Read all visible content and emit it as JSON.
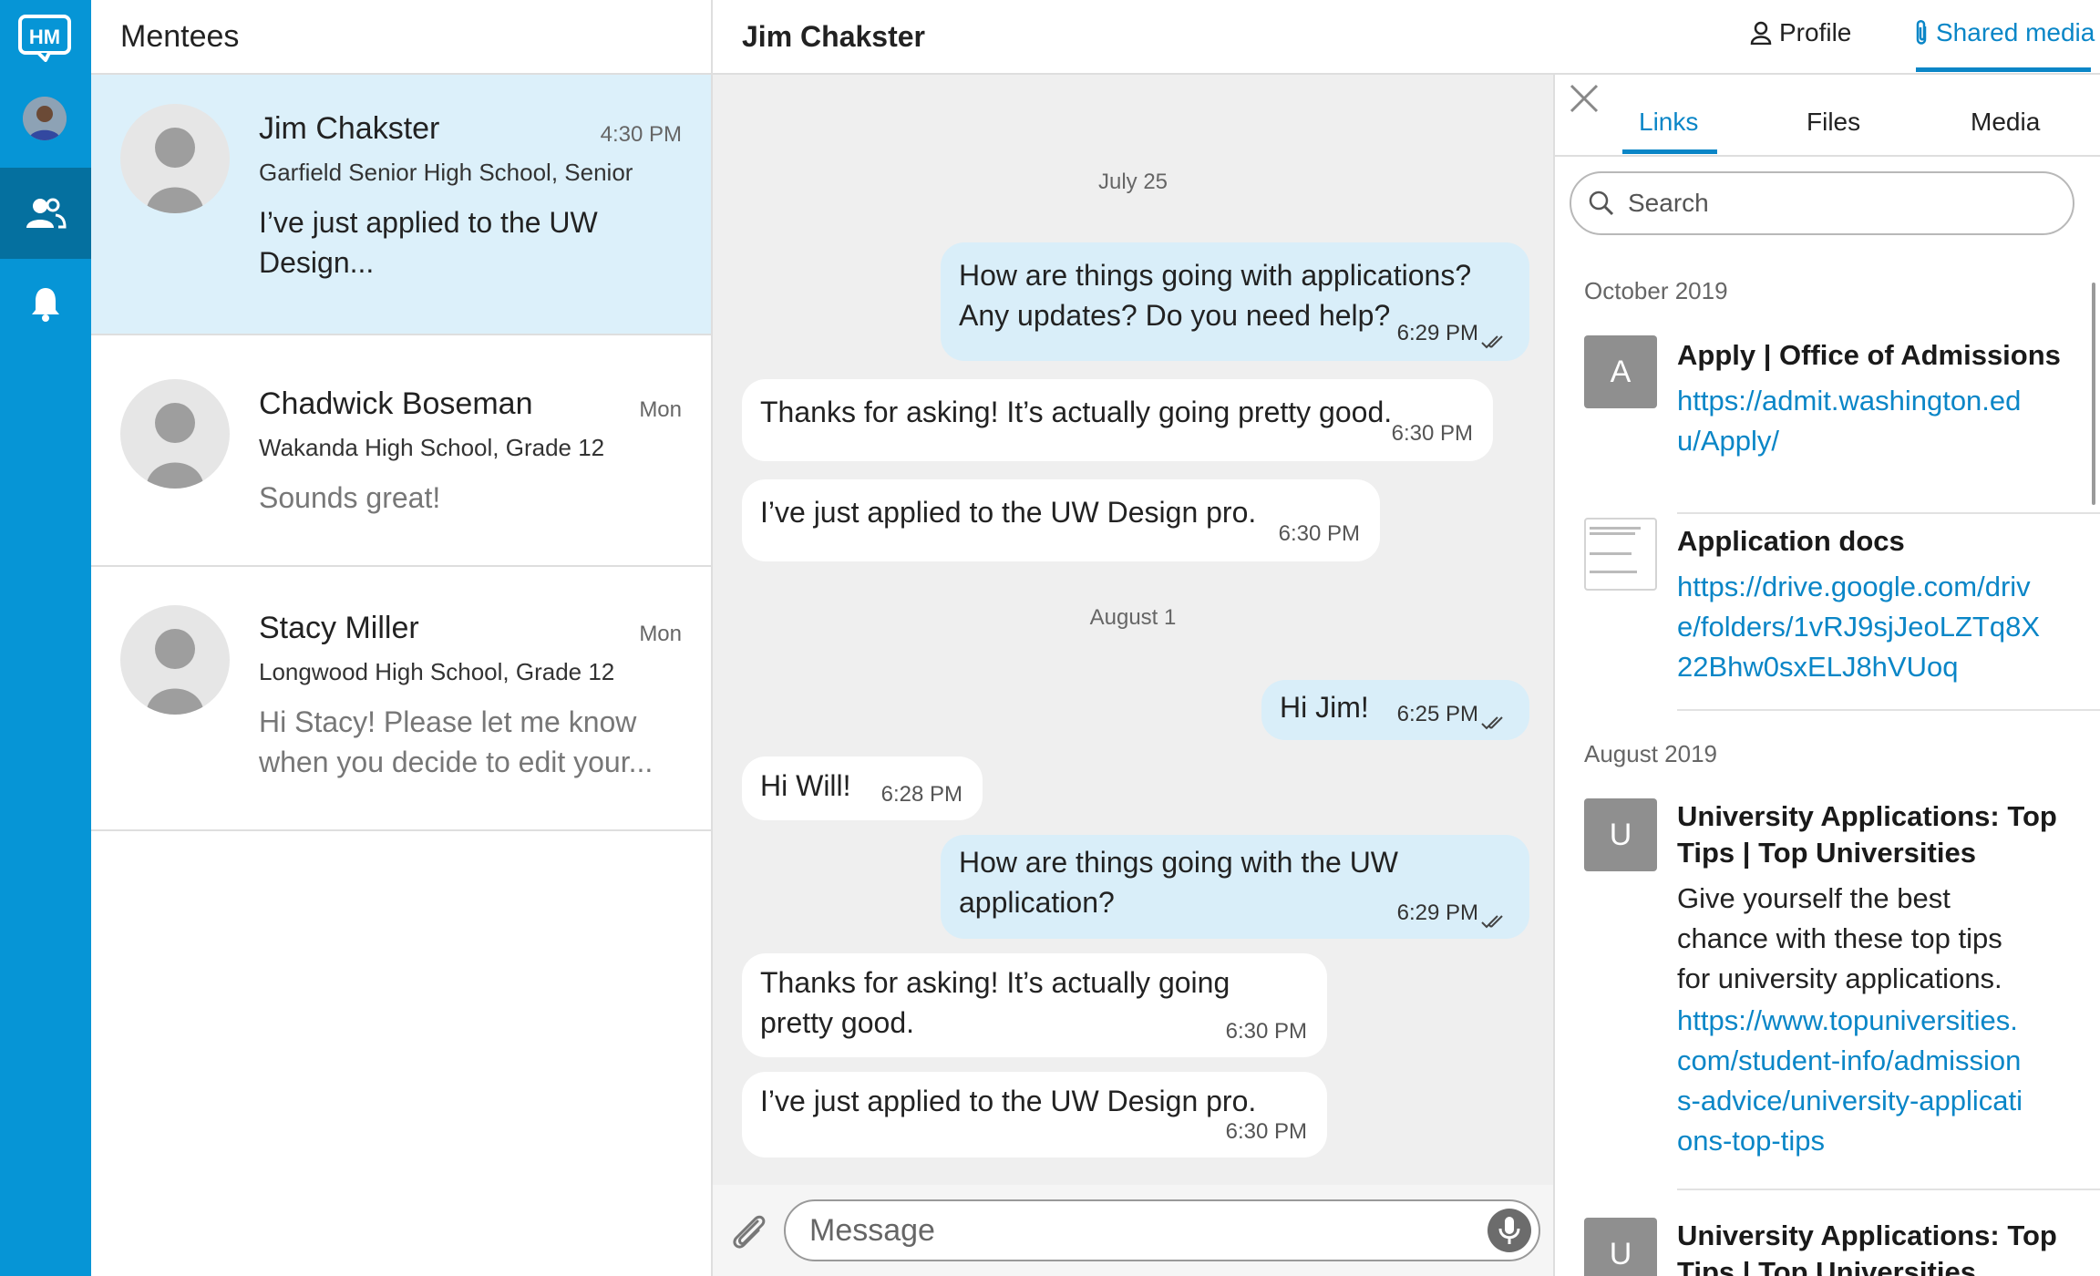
{
  "app": {
    "logo_text": "HM",
    "colors": {
      "rail": "#0695d6",
      "accent": "#0a86c7",
      "active_row": "#dcf0fa",
      "outgoing_bubble": "#d9eef9"
    }
  },
  "rail": {
    "items": [
      {
        "icon": "user-avatar"
      },
      {
        "icon": "people-icon",
        "active": true
      },
      {
        "icon": "bell-icon"
      }
    ]
  },
  "mentees": {
    "title": "Mentees",
    "items": [
      {
        "name": "Jim Chakster",
        "time": "4:30 PM",
        "school": "Garfield Senior High School, Senior",
        "preview_lines": [
          "I’ve just applied to the UW",
          "Design..."
        ],
        "active": true
      },
      {
        "name": "Chadwick Boseman",
        "time": "Mon",
        "school": "Wakanda High School, Grade 12",
        "preview_lines": [
          "Sounds great!"
        ]
      },
      {
        "name": "Stacy Miller",
        "time": "Mon",
        "school": "Longwood High School, Grade 12",
        "preview_lines": [
          "Hi Stacy! Please let me know",
          "when you decide to edit your..."
        ]
      }
    ]
  },
  "chat": {
    "title": "Jim Chakster",
    "dates": [
      "July 25",
      "August 1"
    ],
    "messages": [
      {
        "dir": "out",
        "lines": [
          "How are things going with applications?",
          "Any updates? Do you need help?"
        ],
        "time": "6:29 PM"
      },
      {
        "dir": "in",
        "lines": [
          "Thanks for asking! It’s actually going pretty good."
        ],
        "time": "6:30 PM"
      },
      {
        "dir": "in",
        "lines": [
          "I’ve just applied to the UW Design pro."
        ],
        "time": "6:30 PM"
      },
      {
        "dir": "out",
        "lines": [
          "Hi Jim!"
        ],
        "time": "6:25 PM"
      },
      {
        "dir": "in",
        "lines": [
          "Hi Will!"
        ],
        "time": "6:28 PM"
      },
      {
        "dir": "out",
        "lines": [
          "How are things going with the UW",
          "application?"
        ],
        "time": "6:29 PM"
      },
      {
        "dir": "in",
        "lines": [
          "Thanks for asking! It’s actually going",
          "pretty good."
        ],
        "time": "6:30 PM"
      },
      {
        "dir": "in",
        "lines": [
          "I’ve just applied to the UW Design pro."
        ],
        "time": "6:30 PM"
      }
    ],
    "composer": {
      "placeholder": "Message",
      "attach_icon": "paperclip-icon",
      "mic_icon": "microphone-icon"
    }
  },
  "header_actions": {
    "profile": "Profile",
    "shared_media": "Shared media"
  },
  "shared": {
    "tabs": [
      "Links",
      "Files",
      "Media"
    ],
    "active_tab": "Links",
    "search_placeholder": "Search",
    "groups": [
      {
        "month": "October 2019",
        "links": [
          {
            "thumb": "A",
            "title_lines": [
              "Apply | Office of Admissions"
            ],
            "url_lines": [
              "https://admit.washington.ed",
              "u/Apply/"
            ]
          },
          {
            "thumb": "doc",
            "title_lines": [
              "Application docs"
            ],
            "url_lines": [
              "https://drive.google.com/driv",
              "e/folders/1vRJ9sjJeoLZTq8X",
              "22Bhw0sxELJ8hVUoq"
            ]
          }
        ]
      },
      {
        "month": "August 2019",
        "links": [
          {
            "thumb": "U",
            "title_lines": [
              "University Applications: Top",
              "Tips | Top Universities"
            ],
            "desc_lines": [
              "Give yourself the best",
              "chance with these top tips",
              "for university applications."
            ],
            "url_lines": [
              "https://www.topuniversities.",
              "com/student-info/admission",
              "s-advice/university-applicati",
              "ons-top-tips"
            ]
          },
          {
            "thumb": "U",
            "title_lines": [
              "University Applications: Top",
              "Tips | Top Universities"
            ]
          }
        ]
      }
    ]
  }
}
